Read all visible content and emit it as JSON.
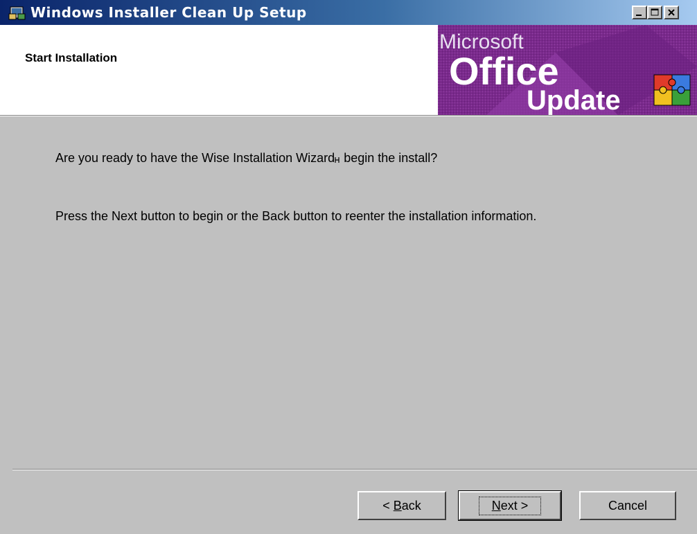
{
  "window": {
    "title": "Windows Installer Clean Up Setup",
    "controls": [
      "minimize-icon",
      "maximize-icon",
      "close-icon"
    ]
  },
  "header": {
    "title": "Start Installation",
    "banner": {
      "line1": "Microsoft",
      "line2": "Office",
      "line3": "Update",
      "icon": "puzzle-icon",
      "bg_color": "#7a2a8c"
    }
  },
  "content": {
    "question_before": "Are you ready to have the Wise Installation Wizard",
    "question_after": " begin the install?",
    "instruction": "Press the Next button to begin or the Back button to reenter the installation information."
  },
  "buttons": {
    "back_prefix": "< ",
    "back_hotkey": "B",
    "back_rest": "ack",
    "next_hotkey": "N",
    "next_rest": "ext >",
    "cancel": "Cancel"
  }
}
